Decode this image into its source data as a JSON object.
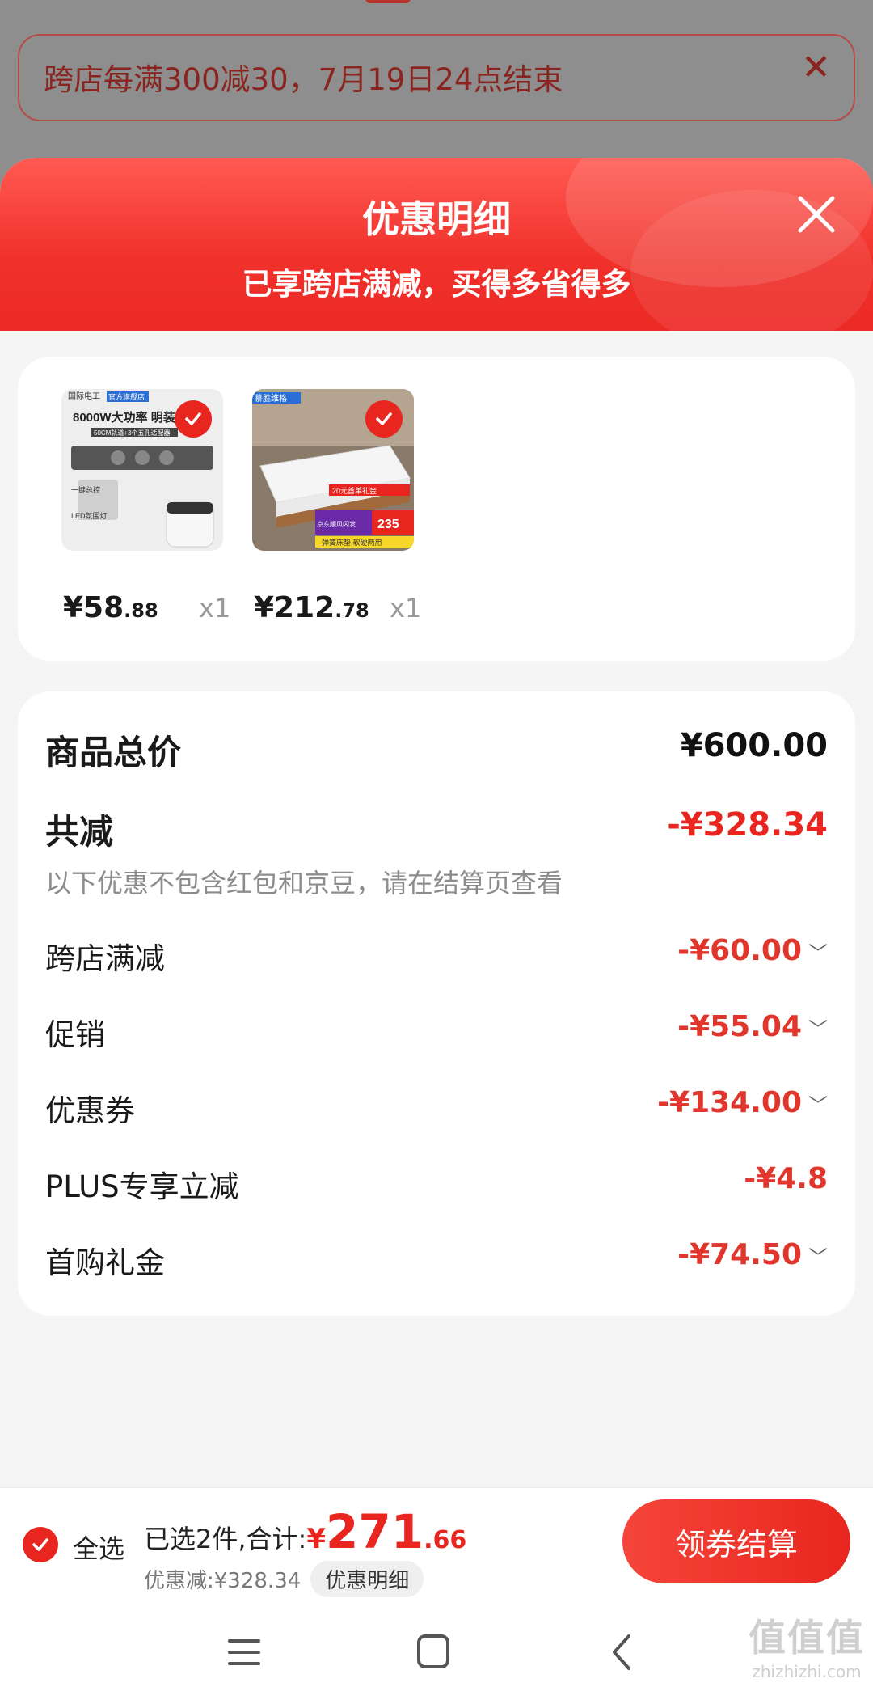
{
  "background": {
    "banner_text": "跨店每满300减30，7月19日24点结束",
    "banner_close": "✕"
  },
  "sheet": {
    "title": "优惠明细",
    "subtitle": "已享跨店满减，买得多省得多"
  },
  "products": [
    {
      "price_int": "¥58",
      "price_dec": ".88",
      "qty": "x1",
      "thumb_texts": {
        "brand": "国际电工",
        "store": "官方旗舰店",
        "headline": "8000W大功率 明装",
        "sub": "50CM轨道+3个五孔适配器",
        "tag1": "一键总控",
        "tag2": "LED氛围灯"
      }
    },
    {
      "price_int": "¥212",
      "price_dec": ".78",
      "qty": "x1",
      "thumb_texts": {
        "brand": "慕胜维格",
        "promo": "20元首单礼金",
        "ship": "京东顺风闪发",
        "num": "235",
        "footer": "弹簧床垫 软硬两用"
      }
    }
  ],
  "details": {
    "total_label": "商品总价",
    "total_value": "¥600.00",
    "reduce_label": "共减",
    "reduce_value": "-¥328.34",
    "note": "以下优惠不包含红包和京豆，请在结算页查看",
    "items": [
      {
        "label": "跨店满减",
        "value": "-¥60.00",
        "chevron": "﹀"
      },
      {
        "label": "促销",
        "value": "-¥55.04",
        "chevron": "﹀"
      },
      {
        "label": "优惠券",
        "value": "-¥134.00",
        "chevron": "﹀"
      },
      {
        "label": "PLUS专享立减",
        "value": "-¥4.8",
        "chevron": ""
      },
      {
        "label": "首购礼金",
        "value": "-¥74.50",
        "chevron": "﹀"
      }
    ]
  },
  "bottom_bar": {
    "select_all": "全选",
    "summary_prefix": "已选2件,合计:",
    "currency": "¥",
    "total_int": "271",
    "total_frac": ".66",
    "discount_text": "优惠减:¥328.34",
    "detail_pill": "优惠明细",
    "checkout": "领券结算"
  },
  "watermark": {
    "main": "值值值",
    "sub": "zhizhizhi.com"
  },
  "colors": {
    "accent": "#e8261f",
    "header": "#f0302a"
  }
}
